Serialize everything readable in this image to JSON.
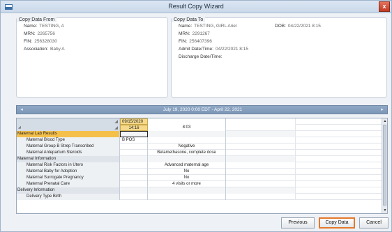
{
  "window": {
    "title": "Result Copy Wizard",
    "close_label": "x"
  },
  "copy_from": {
    "legend": "Copy Data From",
    "fields": [
      {
        "label": "Name:",
        "value": "TESTING, A"
      },
      {
        "label": "MRN:",
        "value": "2265756"
      },
      {
        "label": "FIN:",
        "value": "256328030"
      },
      {
        "label": "Association:",
        "value": "Baby A"
      }
    ]
  },
  "copy_to": {
    "legend": "Copy Data To",
    "fields": [
      {
        "label": "Name:",
        "value": "TESTING, GIRL Ariel"
      },
      {
        "label": "MRN:",
        "value": "2291267"
      },
      {
        "label": "FIN:",
        "value": "256407396"
      },
      {
        "label": "Admit Date/Time:",
        "value": "04/22/2021 8:15"
      },
      {
        "label": "Discharge Date/Time:",
        "value": ""
      }
    ],
    "dob_label": "DOB:",
    "dob_value": "04/22/2021 8:15"
  },
  "range": {
    "text": "July 19, 2020 0:00 EDT - April 22, 2021",
    "left_arrow": "◂",
    "right_arrow": "▸"
  },
  "grid": {
    "header_date": "09/15/2020",
    "header_time_1": "14:16",
    "header_time_2": "8:03",
    "rows": [
      {
        "kind": "section",
        "name": "Maternal Lab Results",
        "v1": "",
        "v2": "",
        "selected": true
      },
      {
        "kind": "sub",
        "name": "Maternal Blood Type",
        "v1": "B POS",
        "v2": ""
      },
      {
        "kind": "sub",
        "name": "Maternal Group B Strep Transcribed",
        "v1": "",
        "v2": "Negative"
      },
      {
        "kind": "sub",
        "name": "Maternal Antepartum Steroids",
        "v1": "",
        "v2": "Betamethasone, complete dose"
      },
      {
        "kind": "section",
        "name": "Maternal Information",
        "v1": "",
        "v2": ""
      },
      {
        "kind": "sub",
        "name": "Maternal Risk Factors in Utero",
        "v1": "",
        "v2": "Advanced maternal age"
      },
      {
        "kind": "sub",
        "name": "Maternal Baby for Adoption",
        "v1": "",
        "v2": "No"
      },
      {
        "kind": "sub",
        "name": "Maternal Surrogate Pregnancy",
        "v1": "",
        "v2": "No"
      },
      {
        "kind": "sub",
        "name": "Maternal Prenatal Care",
        "v1": "",
        "v2": "4 visits or more"
      },
      {
        "kind": "section",
        "name": "Delivery Information",
        "v1": "",
        "v2": ""
      },
      {
        "kind": "sub",
        "name": "Delivery Type Birth",
        "v1": "",
        "v2": ""
      }
    ]
  },
  "buttons": {
    "previous": "Previous",
    "copy": "Copy Data",
    "cancel": "Cancel"
  }
}
